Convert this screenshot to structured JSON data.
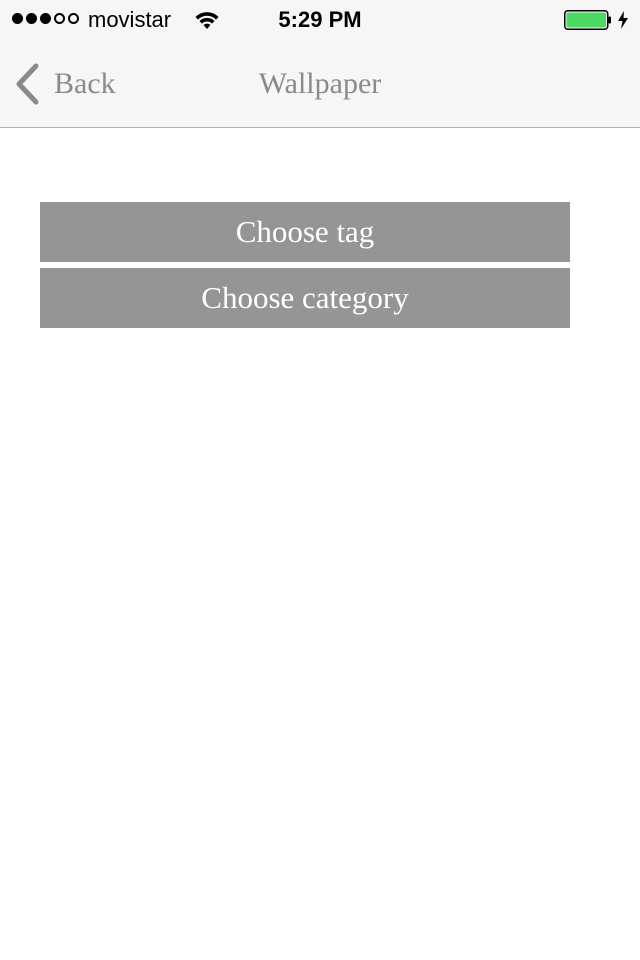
{
  "status_bar": {
    "signal_bars_filled": 3,
    "signal_bars_total": 5,
    "carrier": "movistar",
    "time": "5:29 PM",
    "battery_level": 1.0,
    "battery_color": "#4cd964",
    "charging": true
  },
  "nav": {
    "back_label": "Back",
    "title": "Wallpaper"
  },
  "buttons": {
    "choose_tag": "Choose tag",
    "choose_category": "Choose category"
  },
  "colors": {
    "button_bg": "#959595",
    "nav_text": "#8a8a8a",
    "bar_bg": "#f6f6f6"
  }
}
